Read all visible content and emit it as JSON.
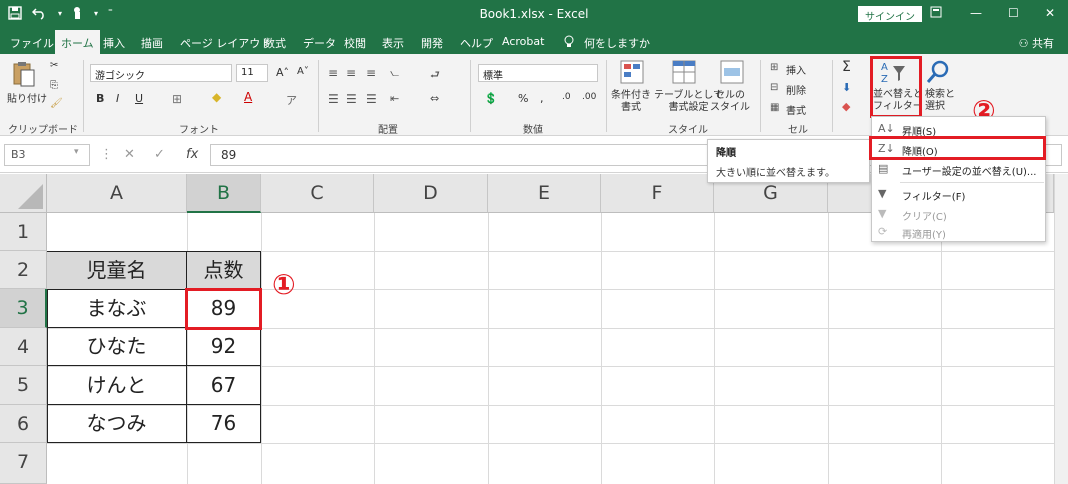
{
  "titlebar": {
    "title": "Book1.xlsx  -  Excel",
    "signin": "サインイン",
    "qat_icons": [
      "save-icon",
      "undo-icon",
      "touch-mode-icon",
      "customize-qat-icon"
    ]
  },
  "tabs": [
    {
      "label": "ファイル"
    },
    {
      "label": "ホーム"
    },
    {
      "label": "挿入"
    },
    {
      "label": "描画"
    },
    {
      "label": "ページ レイアウト"
    },
    {
      "label": "数式"
    },
    {
      "label": "データ"
    },
    {
      "label": "校閲"
    },
    {
      "label": "表示"
    },
    {
      "label": "開発"
    },
    {
      "label": "ヘルプ"
    },
    {
      "label": "Acrobat"
    },
    {
      "label": "何をしますか"
    }
  ],
  "share_label": "共有",
  "ribbon": {
    "clipboard": {
      "paste": "貼り付け",
      "label": "クリップボード"
    },
    "font": {
      "name": "游ゴシック",
      "size": "11",
      "label": "フォント"
    },
    "alignment": {
      "label": "配置"
    },
    "number": {
      "format": "標準",
      "label": "数値"
    },
    "style": {
      "conditional": "条件付き\n書式",
      "table": "テーブルとして\n書式設定",
      "cell_style": "セルの\nスタイル",
      "label": "スタイル"
    },
    "cells": {
      "insert": "挿入",
      "delete": "削除",
      "format": "書式",
      "label": "セル"
    },
    "editing": {
      "sort_filter_1": "並べ替えと",
      "sort_filter_2": "フィルター",
      "find_1": "検索と",
      "find_2": "選択"
    }
  },
  "formula_bar": {
    "namebox": "B3",
    "fx": "fx",
    "value": "89"
  },
  "sheet": {
    "columns": [
      "A",
      "B",
      "C",
      "D",
      "E",
      "F",
      "G"
    ],
    "rows": [
      "1",
      "2",
      "3",
      "4",
      "5",
      "6",
      "7"
    ],
    "table": {
      "headers": [
        "児童名",
        "点数"
      ],
      "rows": [
        [
          "まなぶ",
          "89"
        ],
        [
          "ひなた",
          "92"
        ],
        [
          "けんと",
          "67"
        ],
        [
          "なつみ",
          "76"
        ]
      ]
    }
  },
  "annotations": {
    "marker1": "①",
    "marker2": "②"
  },
  "tooltip": {
    "title": "降順",
    "desc": "大きい順に並べ替えます。"
  },
  "sort_menu": {
    "items": [
      {
        "label": "昇順(S)",
        "icon": "sort-asc-icon",
        "enabled": true
      },
      {
        "label": "降順(O)",
        "icon": "sort-desc-icon",
        "enabled": true
      },
      {
        "label": "ユーザー設定の並べ替え(U)...",
        "icon": "custom-sort-icon",
        "enabled": true
      },
      {
        "label": "フィルター(F)",
        "icon": "filter-icon",
        "enabled": true
      },
      {
        "label": "クリア(C)",
        "icon": "clear-filter-icon",
        "enabled": false
      },
      {
        "label": "再適用(Y)",
        "icon": "reapply-icon",
        "enabled": false
      }
    ]
  },
  "colors": {
    "accent": "#217346",
    "highlight": "#e31c24",
    "header_fill": "#d9d9d9"
  }
}
